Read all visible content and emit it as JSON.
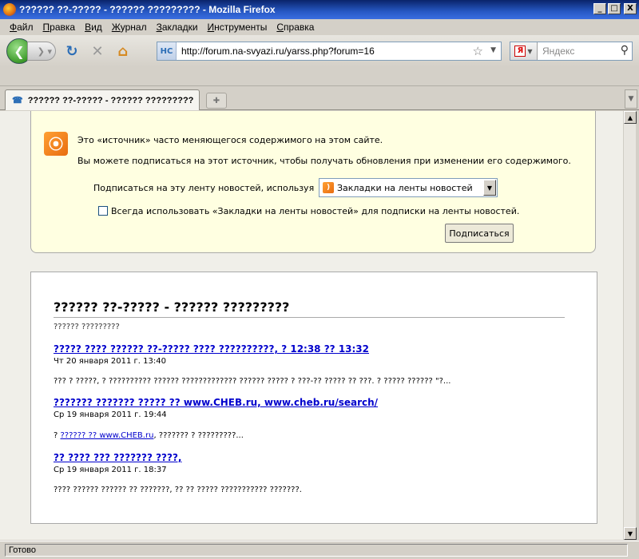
{
  "window": {
    "title": "?????? ??-????? - ?????? ????????? - Mozilla Firefox",
    "buttons": {
      "minimize": "_",
      "maximize": "□",
      "close": "X"
    }
  },
  "menu": [
    "Файл",
    "Правка",
    "Вид",
    "Журнал",
    "Закладки",
    "Инструменты",
    "Справка"
  ],
  "nav": {
    "url": "http://forum.na-svyazi.ru/yarss.php?forum=16",
    "search_placeholder": "Яндекс",
    "search_engine_letter": "Я",
    "site_icon_text": "НС"
  },
  "tabs": [
    {
      "label": "?????? ??-????? - ?????? ?????????",
      "active": true
    }
  ],
  "feed_preview": {
    "line1": "Это «источник» часто меняющегося содержимого на этом сайте.",
    "line2": "Вы можете подписаться на этот источник, чтобы получать обновления при изменении его содержимого.",
    "subscribe_label": "Подписаться на эту ленту новостей, используя",
    "subscribe_option": "Закладки на ленты новостей",
    "always_use_label": "Всегда использовать «Закладки на ленты новостей» для подписки на ленты новостей.",
    "always_use_checked": false,
    "subscribe_button": "Подписаться"
  },
  "feed": {
    "title": "?????? ??-????? - ?????? ?????????",
    "subtitle": "?????? ?????????",
    "entries": [
      {
        "title": "????? ???? ?????? ??-????? ???? ??????????, ? 12:38 ?? 13:32",
        "date": "Чт 20 января 2011 г. 13:40",
        "body": "??? ? ?????, ? ?????????? ?????? ????????????? ?????? ????? ? ???-?? ????? ?? ???. ? ????? ?????? \"?..."
      },
      {
        "title": "??????? ??????? ????? ?? www.CHEB.ru, www.cheb.ru/search/",
        "date": "Ср 19 января 2011 г. 19:44",
        "body_prefix": "? ",
        "body_link": "?????? ?? www.CHEB.ru",
        "body_suffix": ", ??????? ? ?????????..."
      },
      {
        "title": "?? ???? ??? ??????? ????,",
        "date": "Ср 19 января 2011 г. 18:37",
        "body": "???? ?????? ?????? ?? ???????, ?? ?? ????? ??????????? ???????."
      }
    ]
  },
  "status": {
    "text": "Готово"
  }
}
